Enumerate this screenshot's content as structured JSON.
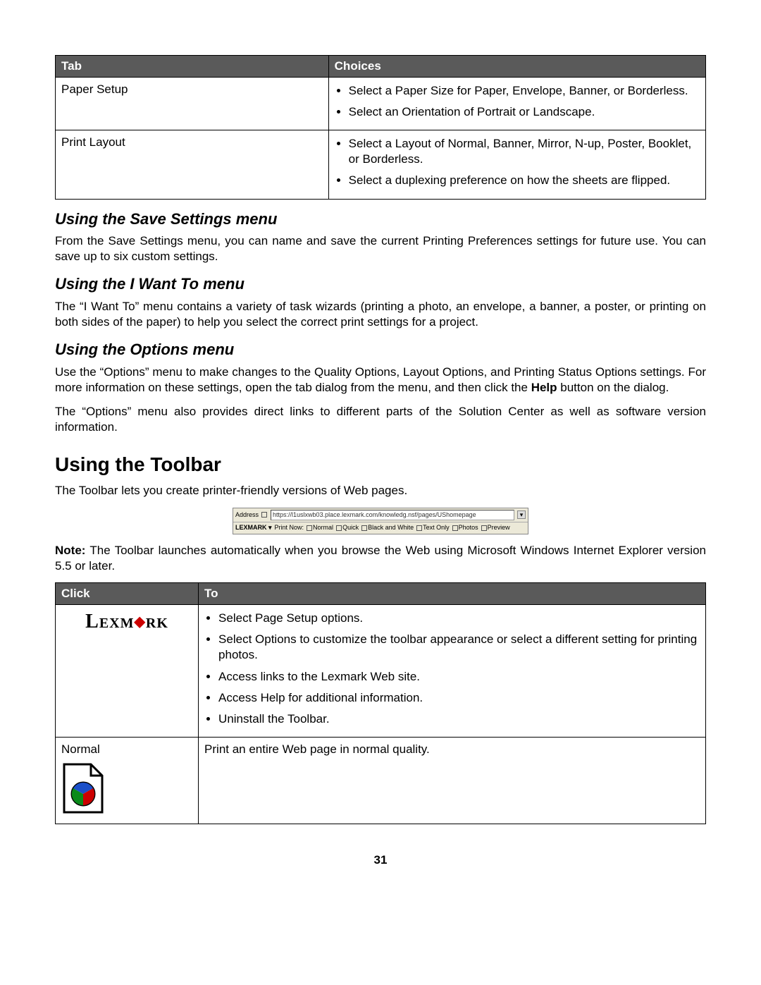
{
  "table1": {
    "headers": [
      "Tab",
      "Choices"
    ],
    "rows": [
      {
        "tab": "Paper Setup",
        "choices": [
          "Select a Paper Size for Paper, Envelope, Banner, or Borderless.",
          "Select an Orientation of Portrait or Landscape."
        ]
      },
      {
        "tab": "Print Layout",
        "choices": [
          "Select a Layout of Normal, Banner, Mirror, N-up, Poster, Booklet, or Borderless.",
          "Select a duplexing preference on how the sheets are flipped."
        ]
      }
    ]
  },
  "sections": {
    "save_settings": {
      "heading": "Using the Save Settings menu",
      "body": "From the Save Settings menu, you can name and save the current Printing Preferences settings for future use. You can save up to six custom settings."
    },
    "i_want_to": {
      "heading": "Using the I Want To menu",
      "body": "The “I Want To” menu contains a variety of task wizards (printing a photo, an envelope, a banner, a poster, or printing on both sides of the paper) to help you select the correct print settings for a project."
    },
    "options": {
      "heading": "Using the Options menu",
      "body1_pre": "Use the “Options” menu to make changes to the Quality Options, Layout Options, and Printing Status Options settings. For more information on these settings, open the tab dialog from the menu, and then click the ",
      "body1_bold": "Help",
      "body1_post": " button on the dialog.",
      "body2": "The “Options” menu also provides direct links to different parts of the Solution Center as well as software version information."
    },
    "toolbar": {
      "heading": "Using the Toolbar",
      "body": "The Toolbar lets you create printer-friendly versions of Web pages.",
      "note_label": "Note:",
      "note_body": " The Toolbar launches automatically when you browse the Web using Microsoft Windows Internet Explorer version 5.5 or later."
    }
  },
  "toolbar_fig": {
    "address_label": "Address",
    "url": "https://l1uslxwb03.place.lexmark.com/knowledg.nsf/pages/UShomepage",
    "brand": "LEXMARK",
    "print_now": "Print Now:",
    "items": [
      "Normal",
      "Quick",
      "Black and White",
      "Text Only",
      "Photos",
      "Preview"
    ]
  },
  "table2": {
    "headers": [
      "Click",
      "To"
    ],
    "rows": [
      {
        "click": "LEXMARK",
        "to": [
          "Select Page Setup options.",
          "Select Options to customize the toolbar appearance or select a different setting for printing photos.",
          "Access links to the Lexmark Web site.",
          "Access Help for additional information.",
          "Uninstall the Toolbar."
        ]
      },
      {
        "click": "Normal",
        "to_text": "Print an entire Web page in normal quality."
      }
    ]
  },
  "page_number": "31"
}
